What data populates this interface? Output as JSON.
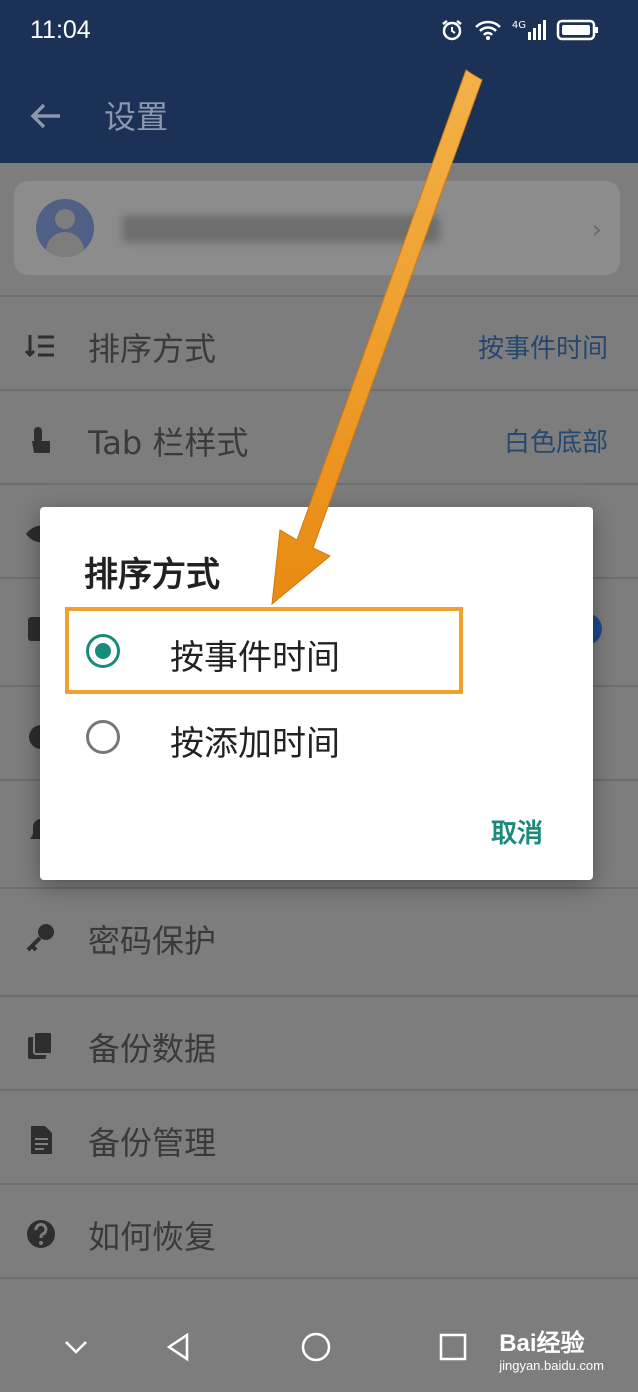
{
  "status_bar": {
    "time": "11:04",
    "icons": [
      "alarm-icon",
      "wifi-icon",
      "signal-4g-icon",
      "battery-icon"
    ],
    "network_label": "4G"
  },
  "app_bar": {
    "title": "设置"
  },
  "account": {
    "blurred_text": "登录 / 注册 iCity 账号"
  },
  "settings": {
    "sort": {
      "label": "排序方式",
      "value": "按事件时间",
      "icon": "sort-icon"
    },
    "tab_style": {
      "label": "Tab 栏样式",
      "value": "白色底部",
      "icon": "touch-icon"
    },
    "password": {
      "label": "密码保护",
      "icon": "key-icon"
    },
    "backup": {
      "label": "备份数据",
      "icon": "copy-icon"
    },
    "backup_manage": {
      "label": "备份管理",
      "icon": "document-icon"
    },
    "restore": {
      "label": "如何恢复",
      "icon": "help-icon"
    }
  },
  "dialog": {
    "title": "排序方式",
    "options": [
      {
        "label": "按事件时间",
        "selected": true
      },
      {
        "label": "按添加时间",
        "selected": false
      }
    ],
    "cancel_label": "取消"
  },
  "watermark": {
    "main": "Bai经验",
    "sub": "jingyan.baidu.com"
  },
  "colors": {
    "app_bar": "#1b3256",
    "accent": "#1a8a7a",
    "highlight": "#f0a030"
  }
}
